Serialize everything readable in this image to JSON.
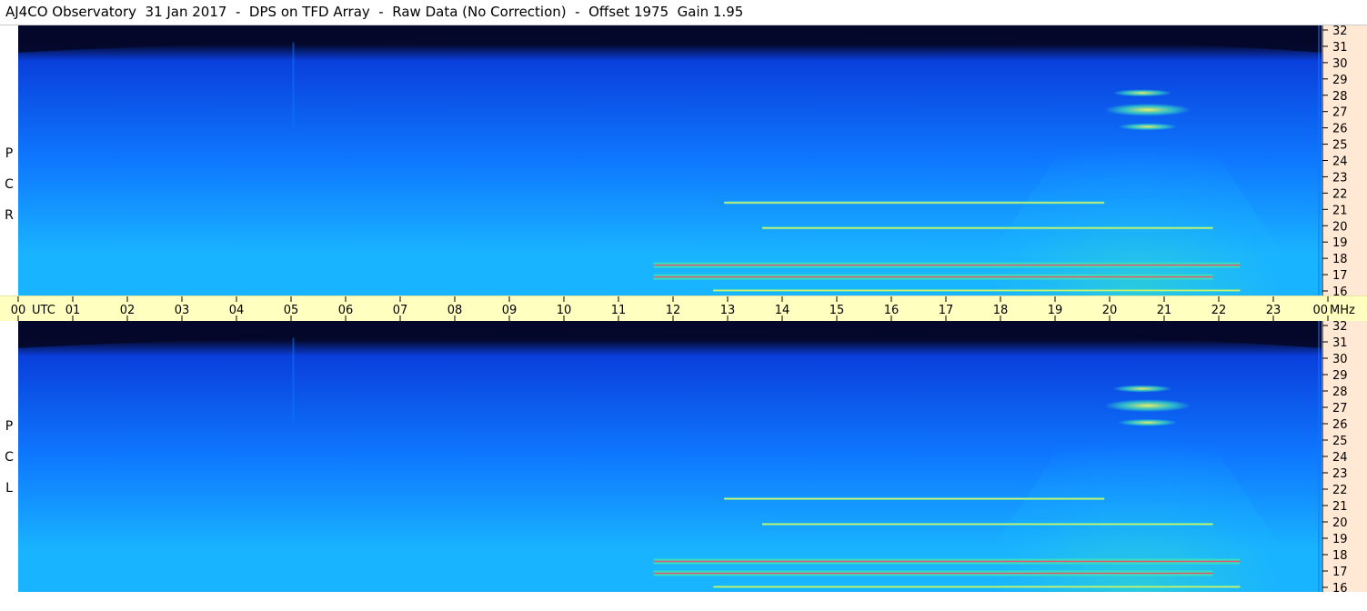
{
  "title": "AJ4CO Observatory  31 Jan 2017  -  DPS on TFD Array  -  Raw Data (No Correction)  -  Offset 1975  Gain 1.95",
  "panels": [
    {
      "id": "rcp",
      "label_letters": [
        "P",
        "C",
        "R"
      ]
    },
    {
      "id": "lcp",
      "label_letters": [
        "P",
        "C",
        "L"
      ]
    }
  ],
  "colors": {
    "background_dark": "#04082a",
    "sky_blue": "#0a3fdc",
    "mid_blue": "#0e78ff",
    "cyan": "#19b4ff",
    "green": "#3ae0c0",
    "yellow": "#f0f060",
    "red": "#ff4060",
    "time_axis_bg": "#ffffc0",
    "freq_axis_bg": "#ffe8d4"
  },
  "chart_data": {
    "type": "heatmap",
    "title": "AJ4CO Observatory  31 Jan 2017  -  DPS on TFD Array  -  Raw Data (No Correction)  -  Offset 1975  Gain 1.95",
    "x_axis": {
      "unit_label": "UTC",
      "ticks": [
        "00",
        "01",
        "02",
        "03",
        "04",
        "05",
        "06",
        "07",
        "08",
        "09",
        "10",
        "11",
        "12",
        "13",
        "14",
        "15",
        "16",
        "17",
        "18",
        "19",
        "20",
        "21",
        "22",
        "23",
        "00"
      ],
      "range": [
        0,
        24
      ]
    },
    "y_axis": {
      "unit_label": "MHz",
      "ticks": [
        "32",
        "31",
        "30",
        "29",
        "28",
        "27",
        "26",
        "25",
        "24",
        "23",
        "22",
        "21",
        "20",
        "19",
        "18",
        "17",
        "16"
      ],
      "range": [
        16,
        32
      ]
    },
    "panels": [
      {
        "name": "RCP",
        "features": [
          {
            "kind": "hill",
            "x_center": 20.6,
            "x_halfwidth": 3.2,
            "peak_freq": 29.0
          },
          {
            "kind": "burst",
            "x_center": 20.8,
            "freq": 27.0,
            "intensity": "high"
          },
          {
            "kind": "burst",
            "x_center": 20.7,
            "freq": 28.0,
            "intensity": "medium"
          },
          {
            "kind": "burst",
            "x_center": 20.8,
            "freq": 26.0,
            "intensity": "medium"
          },
          {
            "kind": "band",
            "x_start": 11.7,
            "x_end": 22.5,
            "freq": 17.8,
            "intensity": "high"
          },
          {
            "kind": "band",
            "x_start": 11.7,
            "x_end": 22.0,
            "freq": 17.1,
            "intensity": "high"
          },
          {
            "kind": "band",
            "x_start": 13.7,
            "x_end": 22.0,
            "freq": 20.0,
            "intensity": "medium"
          },
          {
            "kind": "band",
            "x_start": 13.0,
            "x_end": 20.0,
            "freq": 21.5,
            "intensity": "medium"
          },
          {
            "kind": "band",
            "x_start": 12.8,
            "x_end": 22.5,
            "freq": 16.3,
            "intensity": "medium"
          }
        ]
      },
      {
        "name": "LCP",
        "features": [
          {
            "kind": "hill",
            "x_center": 20.6,
            "x_halfwidth": 3.2,
            "peak_freq": 29.0
          },
          {
            "kind": "burst",
            "x_center": 20.8,
            "freq": 27.0,
            "intensity": "high"
          },
          {
            "kind": "burst",
            "x_center": 20.7,
            "freq": 28.0,
            "intensity": "medium"
          },
          {
            "kind": "burst",
            "x_center": 20.8,
            "freq": 26.0,
            "intensity": "medium"
          },
          {
            "kind": "band",
            "x_start": 11.7,
            "x_end": 22.5,
            "freq": 17.8,
            "intensity": "high"
          },
          {
            "kind": "band",
            "x_start": 11.7,
            "x_end": 22.0,
            "freq": 17.1,
            "intensity": "high"
          },
          {
            "kind": "band",
            "x_start": 13.7,
            "x_end": 22.0,
            "freq": 20.0,
            "intensity": "medium"
          },
          {
            "kind": "band",
            "x_start": 13.0,
            "x_end": 20.0,
            "freq": 21.5,
            "intensity": "medium"
          },
          {
            "kind": "band",
            "x_start": 12.8,
            "x_end": 22.5,
            "freq": 16.3,
            "intensity": "medium"
          }
        ]
      }
    ]
  }
}
